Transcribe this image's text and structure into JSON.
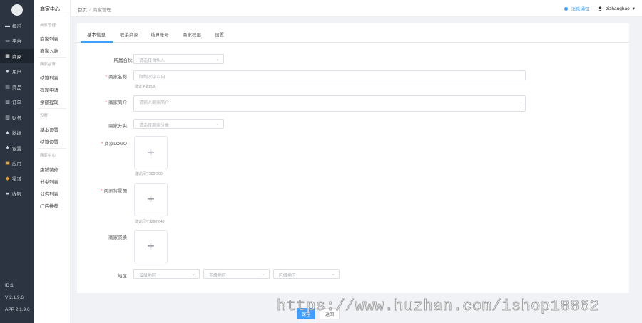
{
  "nav": {
    "items": [
      {
        "label": "概况",
        "icon": "home-icon",
        "glyph": "▬",
        "active": false
      },
      {
        "label": "平台",
        "icon": "computer-icon",
        "glyph": "▭",
        "active": false
      },
      {
        "label": "商家",
        "icon": "store-icon",
        "glyph": "▦",
        "active": true
      },
      {
        "label": "用户",
        "icon": "user-icon",
        "glyph": "●",
        "active": false
      },
      {
        "label": "商品",
        "icon": "goods-icon",
        "glyph": "▤",
        "active": false
      },
      {
        "label": "订单",
        "icon": "order-icon",
        "glyph": "▥",
        "active": false
      },
      {
        "label": "财务",
        "icon": "finance-icon",
        "glyph": "▧",
        "active": false
      },
      {
        "label": "数据",
        "icon": "chart-icon",
        "glyph": "▲",
        "active": false
      },
      {
        "label": "设置",
        "icon": "gear-icon",
        "glyph": "✱",
        "active": false
      },
      {
        "label": "应用",
        "icon": "apps-icon",
        "glyph": "▣",
        "active": false
      },
      {
        "label": "渠道",
        "icon": "channel-icon",
        "glyph": "◆",
        "active": false
      },
      {
        "label": "收银",
        "icon": "cashier-icon",
        "glyph": "▰",
        "active": false
      }
    ],
    "footer": {
      "id": "ID:1",
      "version": "V 2.1.9.6",
      "app_version": "APP 2.1.9.6"
    }
  },
  "submenu": {
    "title": "商家中心",
    "groups": [
      {
        "heading": "商家管理",
        "links": [
          "商家列表",
          "商家入驻"
        ]
      },
      {
        "heading": "商家结算",
        "links": [
          "结算列表",
          "提现申请",
          "余额提现"
        ]
      },
      {
        "heading": "设置",
        "links": [
          "基本设置",
          "结算设置"
        ]
      },
      {
        "heading": "商家中心",
        "links": [
          "店铺装修",
          "分类列表",
          "公告列表",
          "门店推荐"
        ]
      }
    ]
  },
  "header": {
    "breadcrumb": [
      "首页",
      "商家管理"
    ],
    "notice": "消息通知",
    "username": "zizhanghao",
    "caret": "▾"
  },
  "tabs": [
    "基本信息",
    "联系商家",
    "结算账号",
    "商家权限",
    "设置"
  ],
  "form": {
    "partner_label": "所属合伙人",
    "partner_placeholder": "请选择合伙人",
    "name_label": "商家名称",
    "name_placeholder": "限制20字以内",
    "name_hint": "建议字数8/30",
    "intro_label": "商家简介",
    "intro_placeholder": "请输入商家简介",
    "category_label": "商家分类",
    "category_placeholder": "请选择商家分类",
    "logo_label": "商家LOGO",
    "logo_hint": "建议尺寸300*300",
    "bg_label": "商家背景图",
    "bg_hint": "建议尺寸1280*640",
    "qualify_label": "商家资质",
    "region_label": "地区",
    "province_placeholder": "省级地区",
    "city_placeholder": "市级地区",
    "district_placeholder": "区级地区",
    "plus": "+",
    "arrow": "⌄"
  },
  "buttons": {
    "save": "保存",
    "back": "返回"
  },
  "watermark": "https://www.huzhan.com/ishop18862",
  "colors": {
    "accent": "#409eff",
    "nav_bg": "#2b3440",
    "required": "#f56c6c"
  }
}
